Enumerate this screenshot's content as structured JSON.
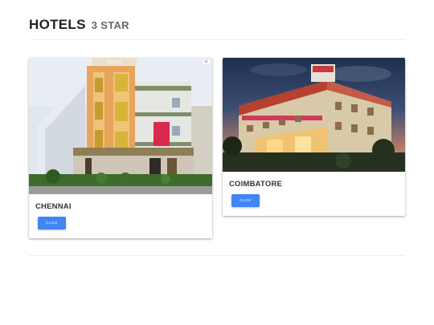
{
  "header": {
    "title": "HOTELS",
    "subtitle": "3 STAR"
  },
  "cards": [
    {
      "city": "CHENNAI",
      "button_label": "CLICK",
      "sign_text": "HOTEL"
    },
    {
      "city": "COIMBATORE",
      "button_label": "CLICK"
    }
  ]
}
